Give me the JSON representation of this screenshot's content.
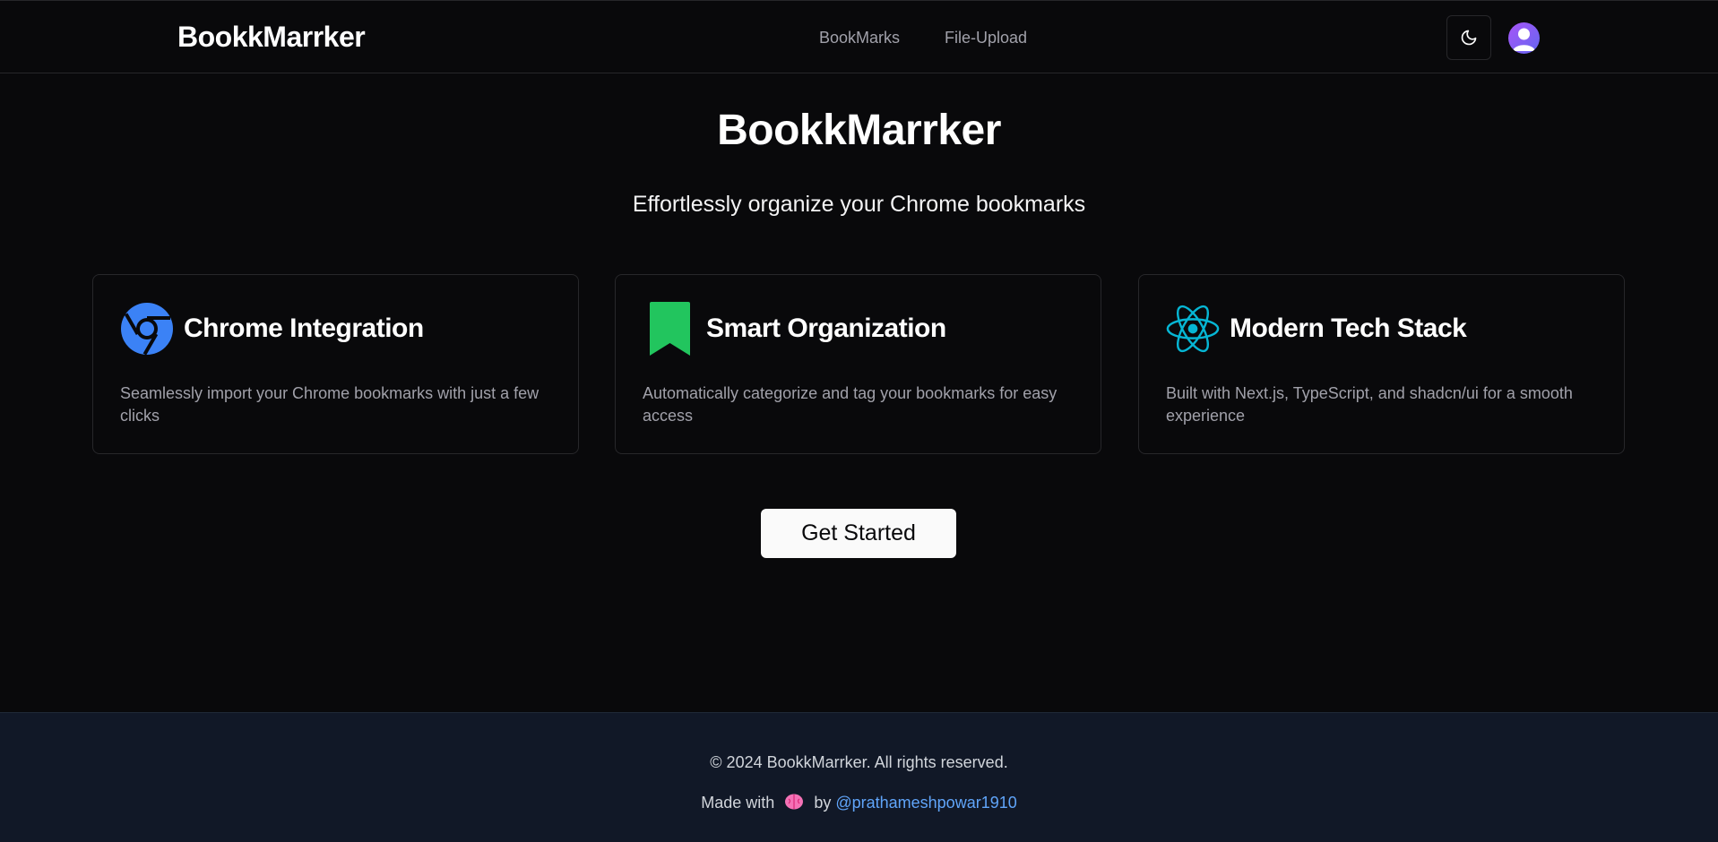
{
  "header": {
    "brand": "BookkMarrker",
    "nav": [
      {
        "label": "BookMarks"
      },
      {
        "label": "File-Upload"
      }
    ],
    "theme_toggle_icon": "moon-icon",
    "avatar_icon": "user-avatar-icon"
  },
  "hero": {
    "title": "BookkMarrker",
    "subtitle": "Effortlessly organize your Chrome bookmarks"
  },
  "features": [
    {
      "icon": "chrome-icon",
      "title": "Chrome Integration",
      "description": "Seamlessly import your Chrome bookmarks with just a few clicks"
    },
    {
      "icon": "bookmark-icon",
      "title": "Smart Organization",
      "description": "Automatically categorize and tag your bookmarks for easy access"
    },
    {
      "icon": "react-icon",
      "title": "Modern Tech Stack",
      "description": "Built with Next.js, TypeScript, and shadcn/ui for a smooth experience"
    }
  ],
  "cta": {
    "label": "Get Started"
  },
  "footer": {
    "copyright": "© 2024 BookkMarrker. All rights reserved.",
    "made_with_prefix": "Made with",
    "made_with_icon": "brain-icon",
    "by_text": "by",
    "author": "@prathameshpowar1910"
  },
  "colors": {
    "background": "#09090b",
    "footer_background": "#111827",
    "chrome_blue": "#3b82f6",
    "bookmark_green": "#22c55e",
    "react_cyan": "#06b6d4",
    "link_blue": "#60a5fa",
    "avatar_purple": "#8b5cf6"
  }
}
